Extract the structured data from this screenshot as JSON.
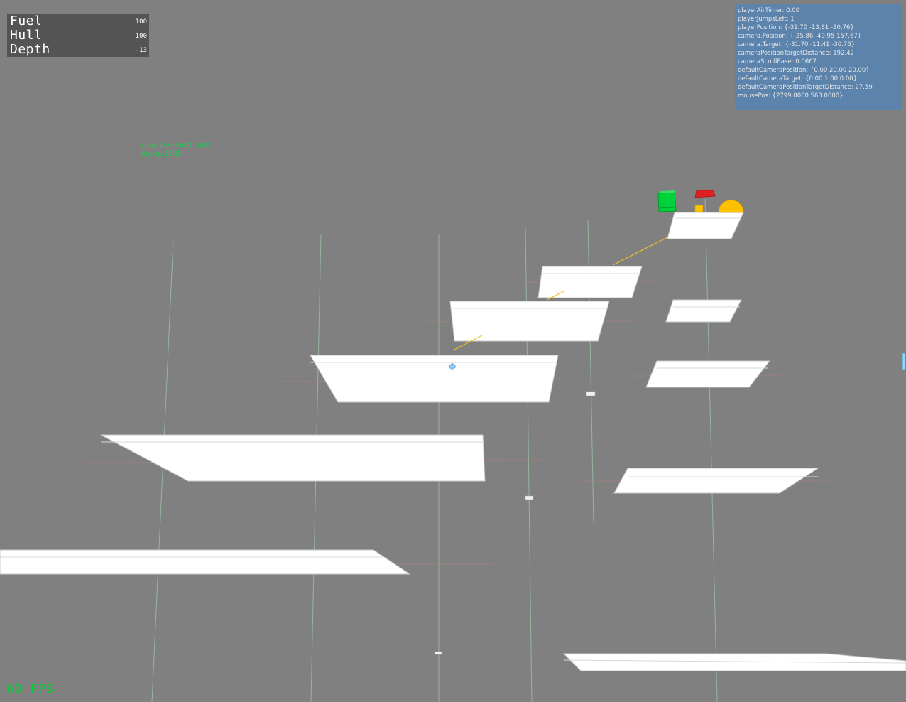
{
  "hud": {
    "fuel_label": "Fuel",
    "fuel_value": "100",
    "hull_label": "Hull",
    "hull_value": "100",
    "depth_label": "Depth",
    "depth_value": "-13"
  },
  "debug": {
    "lines": [
      "playerAirTimer: 0.00",
      "playerJumpsLeft: 1",
      "playerPosition: {-31.70 -13.81 -30.76}",
      "camera.Position: {-25.86 -49.95 157.67}",
      "camera.Target: {-31.70 -11.41 -30.76}",
      "cameraPositionTargetDistance: 192.42",
      "cameraScrollEase: 0.0667",
      "defaultCameraPosition: {0.00 20.00 20.00}",
      "defaultCameraTarget: {0.00 1.00 0.00}",
      "defaultCameraPositionTargetDistance: 27.59",
      "mousePos: {2799.0000 563.0000}"
    ]
  },
  "cross": {
    "cross_text": "cross: {-0.46 0.75 0.62}",
    "degree_text": "degree: 79.55"
  },
  "fps": "60 FPS",
  "colors": {
    "background": "#808080",
    "platform": "#ffffff",
    "player": "#00cc33",
    "red_block": "#e02020",
    "coin": "#ffc400",
    "guide_line": "#f0c020",
    "debug_panel": "#5c83ac",
    "hud_panel": "#545454"
  }
}
